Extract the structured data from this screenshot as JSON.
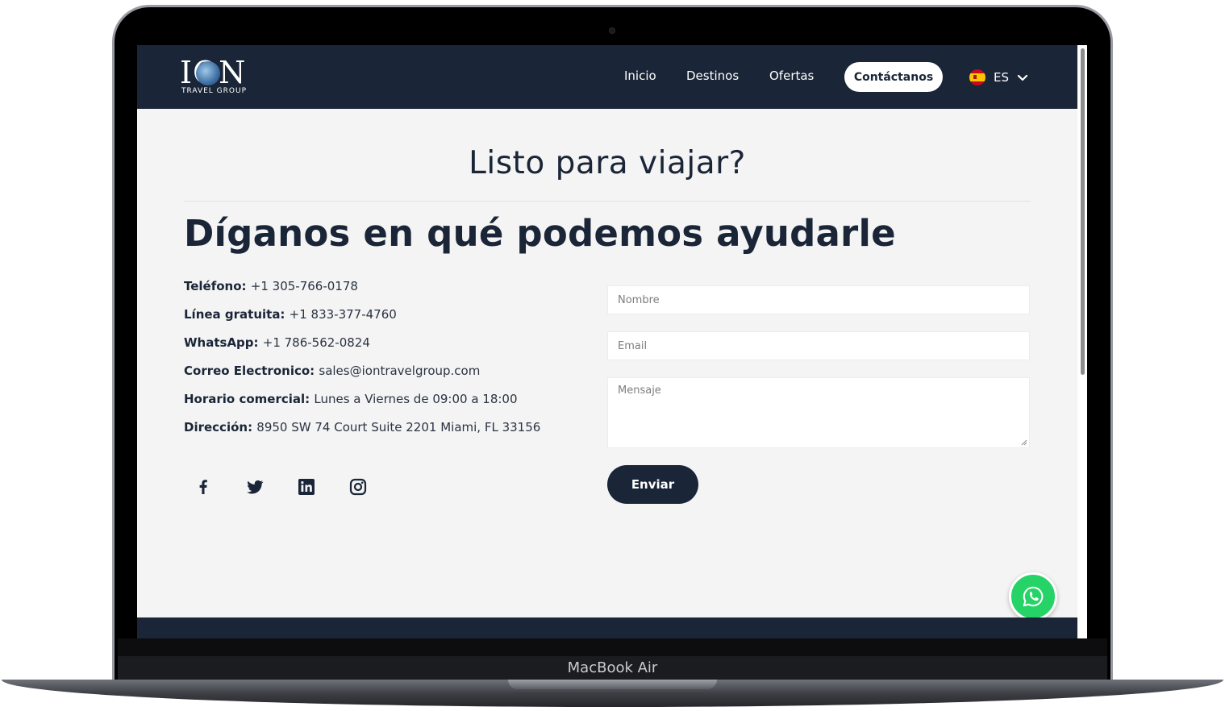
{
  "device": {
    "brand_label": "MacBook Air"
  },
  "header": {
    "logo": {
      "main": "ION",
      "sub": "TRAVEL GROUP"
    },
    "nav": [
      {
        "label": "Inicio"
      },
      {
        "label": "Destinos"
      },
      {
        "label": "Ofertas"
      }
    ],
    "contact_label": "Contáctanos",
    "language": {
      "code": "ES",
      "flag": "spain-flag-icon"
    }
  },
  "main": {
    "eyebrow": "Listo para viajar?",
    "headline": "Díganos en qué podemos ayudarle",
    "contact_info": [
      {
        "label": "Teléfono:",
        "value": "+1 305-766-0178"
      },
      {
        "label": "Línea gratuita:",
        "value": "+1 833-377-4760"
      },
      {
        "label": "WhatsApp:",
        "value": "+1 786-562-0824"
      },
      {
        "label": "Correo Electronico:",
        "value": "sales@iontravelgroup.com"
      },
      {
        "label": "Horario comercial:",
        "value": "Lunes a Viernes de 09:00 a 18:00"
      },
      {
        "label": "Dirección:",
        "value": "8950 SW 74 Court Suite 2201 Miami, FL 33156"
      }
    ],
    "socials": [
      "facebook-icon",
      "twitter-icon",
      "linkedin-icon",
      "instagram-icon"
    ],
    "form": {
      "name_placeholder": "Nombre",
      "email_placeholder": "Email",
      "message_placeholder": "Mensaje",
      "submit_label": "Enviar"
    }
  },
  "colors": {
    "navy": "#1a2537",
    "background": "#f4f4f4",
    "whatsapp": "#25d366"
  }
}
